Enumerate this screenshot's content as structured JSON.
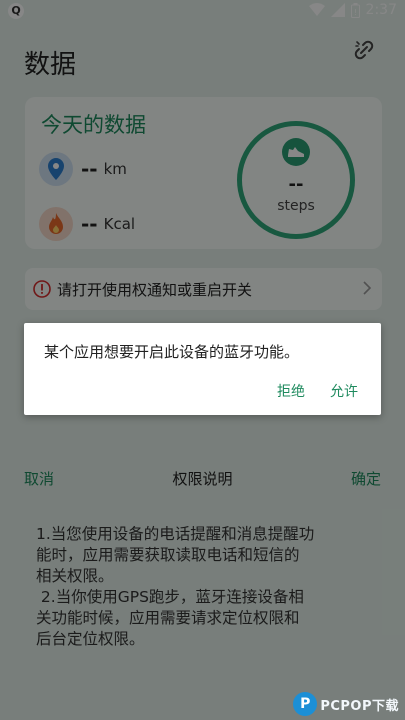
{
  "status_bar": {
    "time": "2:37",
    "app_badge": "Q"
  },
  "app": {
    "title": "数据",
    "link_icon": "link-icon"
  },
  "today_card": {
    "title": "今天的数据",
    "distance": {
      "value": "--",
      "unit": "km",
      "icon": "location-pin-icon"
    },
    "calories": {
      "value": "--",
      "unit": "Kcal",
      "icon": "flame-icon"
    },
    "steps": {
      "value": "--",
      "unit": "steps",
      "icon": "shoe-icon"
    }
  },
  "alert": {
    "text": "请打开使用权通知或重启开关"
  },
  "permission": {
    "cancel": "取消",
    "title": "权限说明",
    "ok": "确定",
    "lines": [
      "1.当您使用设备的电话提醒和消息提醒功",
      "能时，应用需要获取读取电话和短信的",
      "相关权限。",
      " 2.当你使用GPS跑步，蓝牙连接设备相",
      "关功能时候，应用需要请求定位权限和",
      "后台定位权限。"
    ]
  },
  "dialog": {
    "message": "某个应用想要开启此设备的蓝牙功能。",
    "deny": "拒绝",
    "allow": "允许"
  },
  "watermark": {
    "logo": "P",
    "text": "PCPOP下载"
  },
  "colors": {
    "accent": "#1e8a5e",
    "ring": "#2fa77a",
    "background": "#e2efe8",
    "alert_red": "#d32f2f"
  }
}
